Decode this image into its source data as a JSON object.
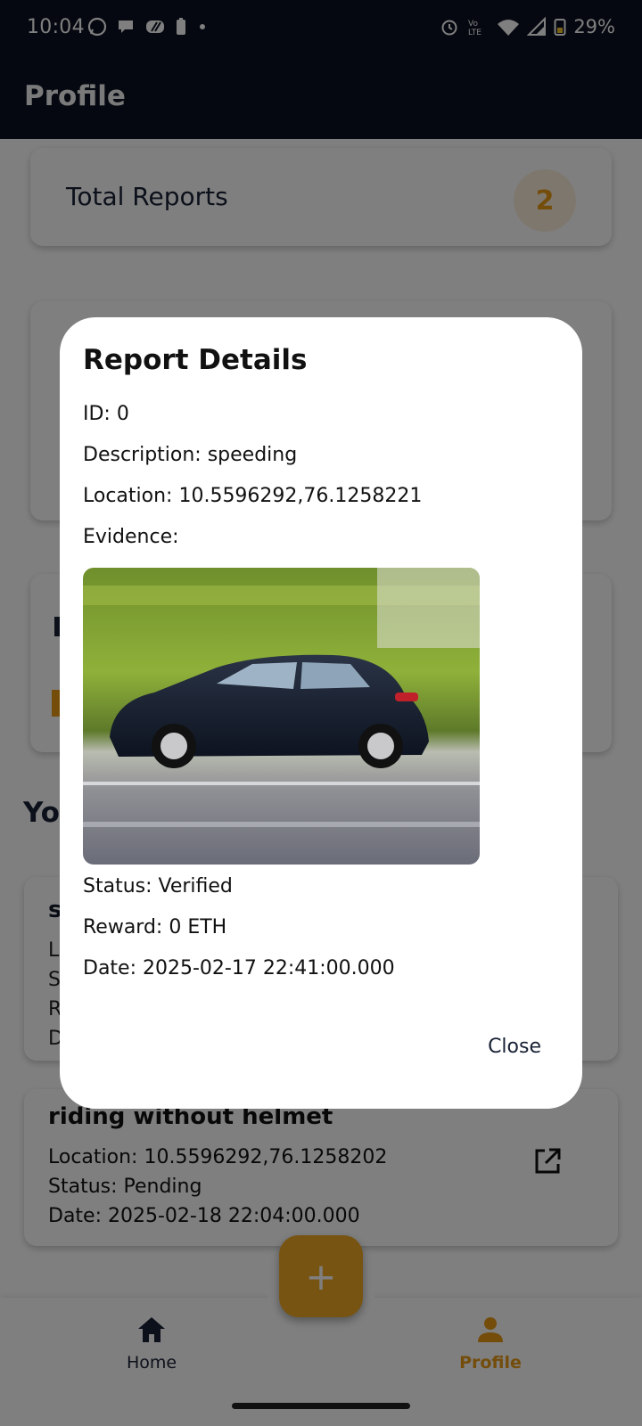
{
  "status_bar": {
    "time": "10:04",
    "battery": "29%"
  },
  "app_bar": {
    "title": "Profile"
  },
  "stats": {
    "total_label": "Total Reports",
    "total_count": "2"
  },
  "section": {
    "title_visible": "Yo"
  },
  "report_cards": [
    {
      "title_visible": "s",
      "line_initials": [
        "L",
        "S",
        "R",
        "D"
      ]
    },
    {
      "title": "riding without helmet",
      "location": "Location: 10.5596292,76.1258202",
      "status": "Status: Pending",
      "date": "Date: 2025-02-18 22:04:00.000",
      "open_icon": "open-in-new-icon"
    }
  ],
  "bottom_nav": {
    "home_label": "Home",
    "profile_label": "Profile",
    "fab_icon": "+"
  },
  "dialog": {
    "title": "Report Details",
    "id": "ID: 0",
    "description": "Description: speeding",
    "location": "Location: 10.5596292,76.1258221",
    "evidence_label": "Evidence:",
    "evidence_image": "blurred-car-photo",
    "status": "Status: Verified",
    "reward": "Reward: 0 ETH",
    "date": "Date: 2025-02-17 22:41:00.000",
    "close_label": "Close"
  },
  "colors": {
    "app_bar": "#0b1020",
    "accent": "#f1a825",
    "scrim": "rgba(0,0,0,0.5)"
  }
}
